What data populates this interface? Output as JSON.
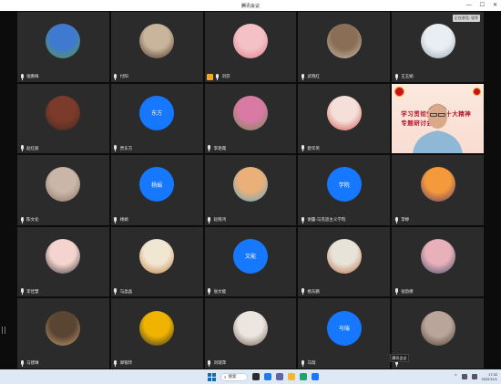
{
  "window": {
    "title": "腾讯会议"
  },
  "floating_label": "正在讲话: 张军",
  "tooltip": "腾讯会议",
  "participants": [
    {
      "name": "张鹏梅",
      "avatar": {
        "kind": "image",
        "colors": [
          "#3f7ad0",
          "#5e9a3b"
        ]
      }
    },
    {
      "name": "付阳",
      "avatar": {
        "kind": "image",
        "colors": [
          "#c9b59b",
          "#4a2e25"
        ]
      }
    },
    {
      "name": "刘芬",
      "hand_raised": true,
      "avatar": {
        "kind": "image",
        "colors": [
          "#f3c1c6",
          "#e07c8a"
        ]
      }
    },
    {
      "name": "武晓红",
      "avatar": {
        "kind": "image",
        "colors": [
          "#8a6e55",
          "#c9c0ad"
        ]
      }
    },
    {
      "name": "王玉娟",
      "avatar": {
        "kind": "image",
        "colors": [
          "#e9eef2",
          "#9aa6b3"
        ]
      }
    },
    {
      "name": "赵红丽",
      "avatar": {
        "kind": "image",
        "colors": [
          "#7c3a2b",
          "#3d2a1d"
        ]
      }
    },
    {
      "name": "贾东方",
      "avatar": {
        "kind": "text",
        "text": "东方"
      }
    },
    {
      "name": "李艳霞",
      "avatar": {
        "kind": "image",
        "colors": [
          "#d97aa5",
          "#6f8d4a"
        ]
      }
    },
    {
      "name": "楚华英",
      "avatar": {
        "kind": "image",
        "colors": [
          "#f4e0d8",
          "#d14f4f"
        ]
      }
    },
    {
      "name": "张军",
      "avatar": {
        "kind": "video"
      }
    },
    {
      "name": "陈文化",
      "avatar": {
        "kind": "image",
        "colors": [
          "#c9b6a8",
          "#8c6f63"
        ]
      }
    },
    {
      "name": "杨娟",
      "avatar": {
        "kind": "text",
        "text": "杨娟"
      }
    },
    {
      "name": "赵晓鸿",
      "avatar": {
        "kind": "image",
        "colors": [
          "#e9b07a",
          "#59a6c9"
        ]
      }
    },
    {
      "name": "谢露-马克思主义学院",
      "avatar": {
        "kind": "text",
        "text": "学院"
      }
    },
    {
      "name": "李婷",
      "avatar": {
        "kind": "image",
        "colors": [
          "#f59a3b",
          "#5a3c6e"
        ]
      }
    },
    {
      "name": "李佳慧",
      "avatar": {
        "kind": "image",
        "colors": [
          "#f5d4cf",
          "#3a3a3a"
        ]
      }
    },
    {
      "name": "马晶晶",
      "avatar": {
        "kind": "image",
        "colors": [
          "#f0e6d2",
          "#c07a3a"
        ]
      }
    },
    {
      "name": "张文能",
      "avatar": {
        "kind": "text",
        "text": "文能"
      }
    },
    {
      "name": "杨东鹏",
      "avatar": {
        "kind": "image",
        "colors": [
          "#e8e3d8",
          "#b8683e"
        ]
      }
    },
    {
      "name": "张韵倩",
      "avatar": {
        "kind": "image",
        "colors": [
          "#e8b0b8",
          "#3b4a6a"
        ]
      }
    },
    {
      "name": "马建琳",
      "avatar": {
        "kind": "image",
        "colors": [
          "#5a4432",
          "#c8a070"
        ]
      }
    },
    {
      "name": "郑银玲",
      "avatar": {
        "kind": "image",
        "colors": [
          "#f0b400",
          "#2a2a2a"
        ]
      }
    },
    {
      "name": "刘瑞萍",
      "avatar": {
        "kind": "image",
        "colors": [
          "#ece6e0",
          "#6a5a4f"
        ]
      }
    },
    {
      "name": "马瑞",
      "avatar": {
        "kind": "text",
        "text": "马瑞"
      }
    },
    {
      "name": "",
      "avatar": {
        "kind": "image",
        "colors": [
          "#b9a59a",
          "#4a3a33"
        ]
      }
    }
  ],
  "video_feed": {
    "banner": "学习贯彻党的二十大精神专题研讨会"
  },
  "taskbar": {
    "search_label": "搜索",
    "time": "17:32",
    "date": "2022/11/1",
    "apps": [
      {
        "name": "taskview-icon",
        "color": "#2b2b2b"
      },
      {
        "name": "widgets-icon",
        "color": "#1f7aec"
      },
      {
        "name": "chat-icon",
        "color": "#6264a7"
      },
      {
        "name": "explorer-icon",
        "color": "#f2b632"
      },
      {
        "name": "edge-icon",
        "color": "#1fa36b"
      },
      {
        "name": "tencent-meeting-icon",
        "color": "#1677ff"
      }
    ]
  }
}
